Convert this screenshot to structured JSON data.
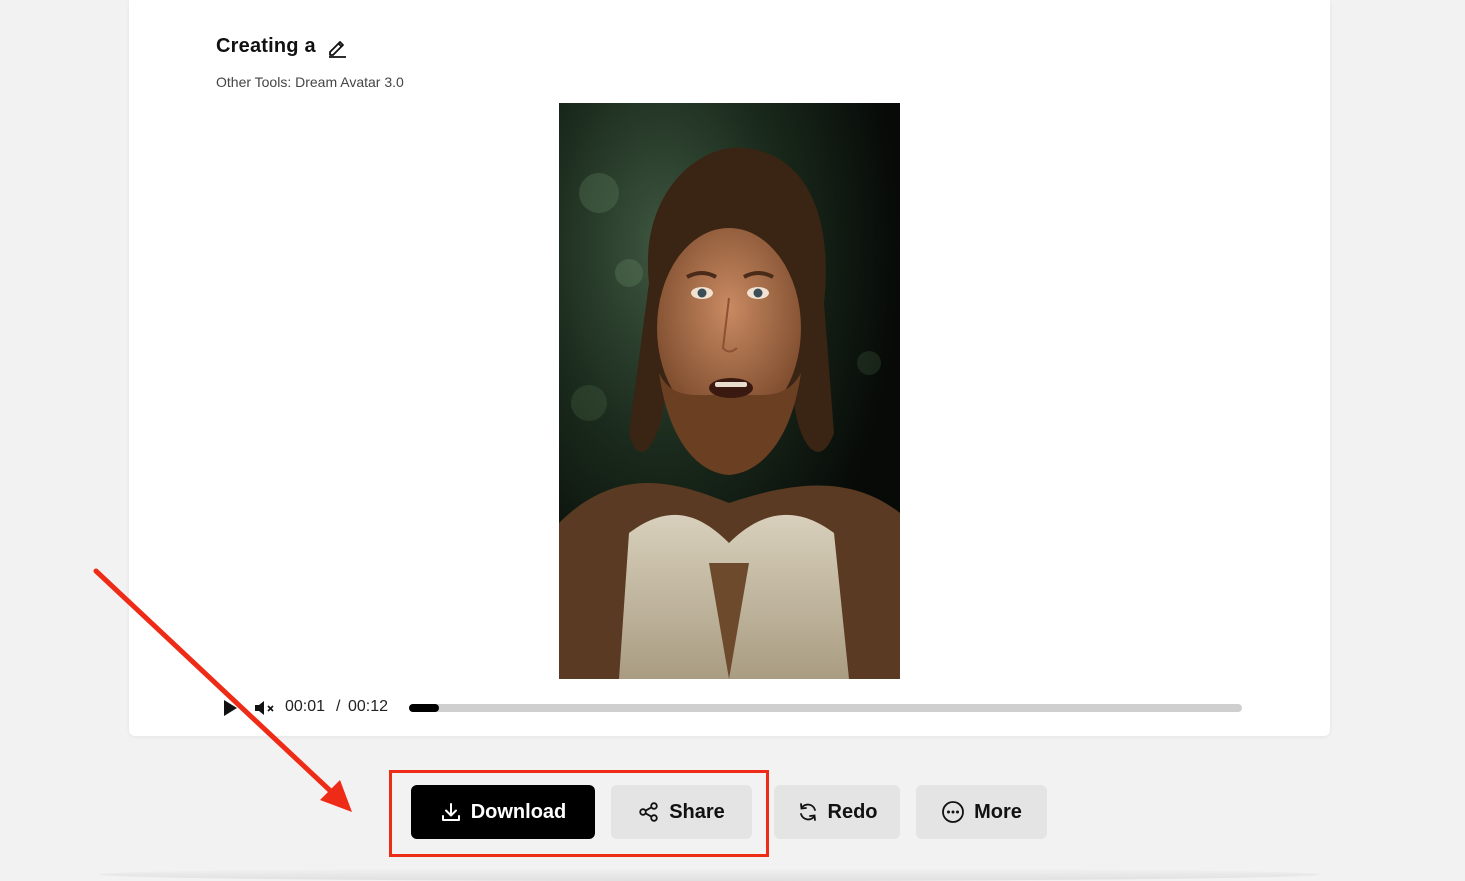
{
  "header": {
    "title": "Creating a",
    "subtitle": "Other Tools: Dream Avatar 3.0"
  },
  "player": {
    "current_time": "00:01",
    "separator": "/",
    "total_time": "00:12",
    "progress_fraction": 0.036
  },
  "actions": {
    "download_label": "Download",
    "share_label": "Share",
    "redo_label": "Redo",
    "more_label": "More"
  },
  "colors": {
    "primary_button": "#000000",
    "secondary_button": "#e4e4e4",
    "annotation": "#ee2b16"
  },
  "icons": [
    "edit-icon",
    "play-icon",
    "mute-icon",
    "download-icon",
    "share-icon",
    "redo-icon",
    "more-icon"
  ]
}
